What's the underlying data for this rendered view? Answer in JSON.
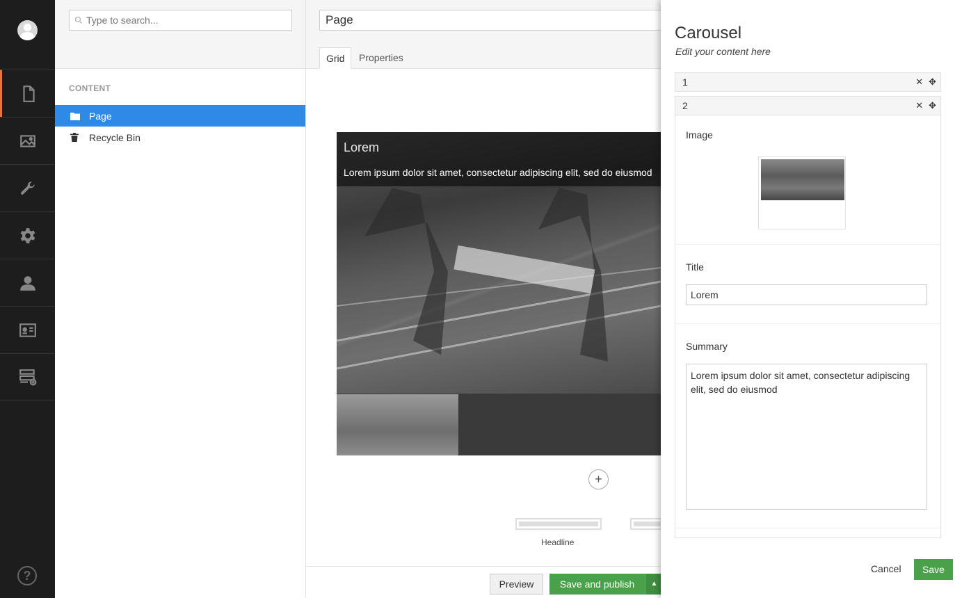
{
  "sections": [
    {
      "icon": "document-icon",
      "name": "content"
    },
    {
      "icon": "image-icon",
      "name": "media"
    },
    {
      "icon": "wrench-icon",
      "name": "settings"
    },
    {
      "icon": "gear-icon",
      "name": "developer"
    },
    {
      "icon": "user-icon",
      "name": "users"
    },
    {
      "icon": "id-card-icon",
      "name": "members"
    },
    {
      "icon": "forms-icon",
      "name": "forms"
    }
  ],
  "tree": {
    "search_placeholder": "Type to search...",
    "caption": "CONTENT",
    "items": [
      {
        "label": "Page",
        "selected": true,
        "icon": "folder-icon"
      },
      {
        "label": "Recycle Bin",
        "selected": false,
        "icon": "trash-icon"
      }
    ]
  },
  "editor": {
    "name": "Page",
    "tabs": [
      {
        "label": "Grid",
        "active": true
      },
      {
        "label": "Properties",
        "active": false
      }
    ],
    "carousel": {
      "title": "Lorem",
      "text": "Lorem ipsum dolor sit amet, consectetur adipiscing elit, sed do eiusmod"
    },
    "layout_label": "Headline",
    "buttons": {
      "preview": "Preview",
      "publish": "Save and publish"
    }
  },
  "dialog": {
    "title": "Carousel",
    "subtitle": "Edit your content here",
    "items": [
      {
        "label": "1"
      },
      {
        "label": "2"
      }
    ],
    "fields": {
      "image_label": "Image",
      "title_label": "Title",
      "title_value": "Lorem",
      "summary_label": "Summary",
      "summary_value": "Lorem ipsum dolor sit amet, consectetur adipiscing elit, sed do eiusmod"
    },
    "cancel": "Cancel",
    "save": "Save"
  },
  "colors": {
    "accent_orange": "#e07a3b",
    "selected_blue": "#2e8ae6",
    "success_green": "#49a24a",
    "appbar_dark": "#1d1d1d"
  }
}
